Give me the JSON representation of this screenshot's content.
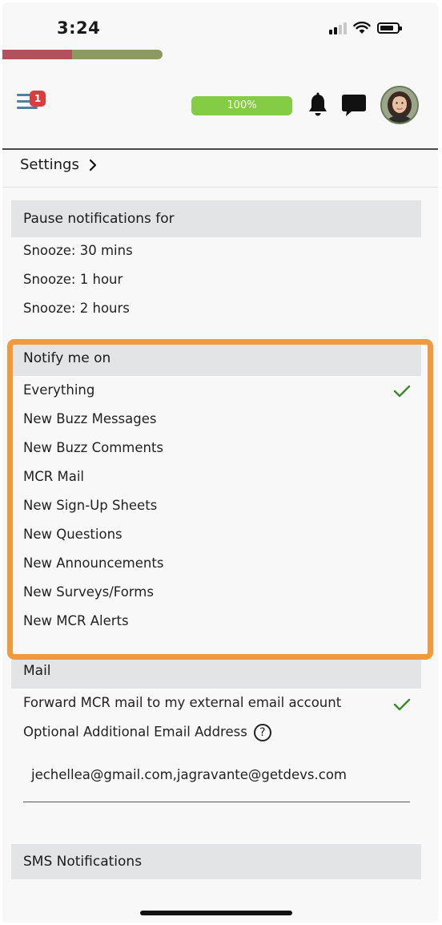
{
  "status_bar": {
    "time": "3:24"
  },
  "progress_strip": {
    "colors": [
      "#b0515b",
      "#8c9a62"
    ]
  },
  "header": {
    "menu_badge": "1",
    "progress_pill": "100%",
    "icons": [
      "menu-icon",
      "bell-icon",
      "chat-icon",
      "avatar"
    ]
  },
  "breadcrumb": {
    "label": "Settings",
    "chevron": ">"
  },
  "pause": {
    "title": "Pause notifications for",
    "items": [
      "Snooze: 30 mins",
      "Snooze: 1 hour",
      "Snooze: 2 hours"
    ]
  },
  "notify": {
    "title": "Notify me on",
    "items": [
      {
        "label": "Everything",
        "checked": true
      },
      {
        "label": "New Buzz Messages",
        "checked": false
      },
      {
        "label": "New Buzz Comments",
        "checked": false
      },
      {
        "label": "MCR Mail",
        "checked": false
      },
      {
        "label": "New Sign-Up Sheets",
        "checked": false
      },
      {
        "label": "New Questions",
        "checked": false
      },
      {
        "label": "New Announcements",
        "checked": false
      },
      {
        "label": "New Surveys/Forms",
        "checked": false
      },
      {
        "label": "New MCR Alerts",
        "checked": false
      }
    ]
  },
  "mail": {
    "title": "Mail",
    "forward_label": "Forward MCR mail to my external email account",
    "forward_checked": true,
    "optional_label": "Optional Additional Email Address",
    "help_glyph": "?",
    "email_value": "jechellea@gmail.com,jagravante@getdevs.com"
  },
  "sms": {
    "title": "SMS Notifications"
  },
  "colors": {
    "accent_orange": "#f09a3e",
    "check_green": "#3d8a2e",
    "pill_green": "#85cc45",
    "badge_red": "#d83e3e"
  }
}
